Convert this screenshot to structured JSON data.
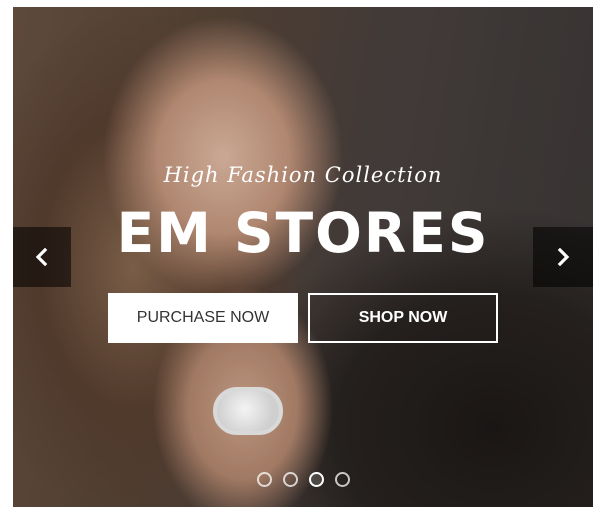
{
  "hero": {
    "subtitle": "High Fashion Collection",
    "title": "EM STORES",
    "buttons": {
      "purchase_label": "PURCHASE NOW",
      "shop_label": "SHOP NOW"
    },
    "nav": {
      "prev_icon": "chevron-left-icon",
      "next_icon": "chevron-right-icon"
    },
    "slides": {
      "count": 4,
      "active_index": 3
    }
  },
  "colors": {
    "text": "#ffffff",
    "button_text_dark": "#333333",
    "arrow_bg": "rgba(0,0,0,0.55)"
  }
}
